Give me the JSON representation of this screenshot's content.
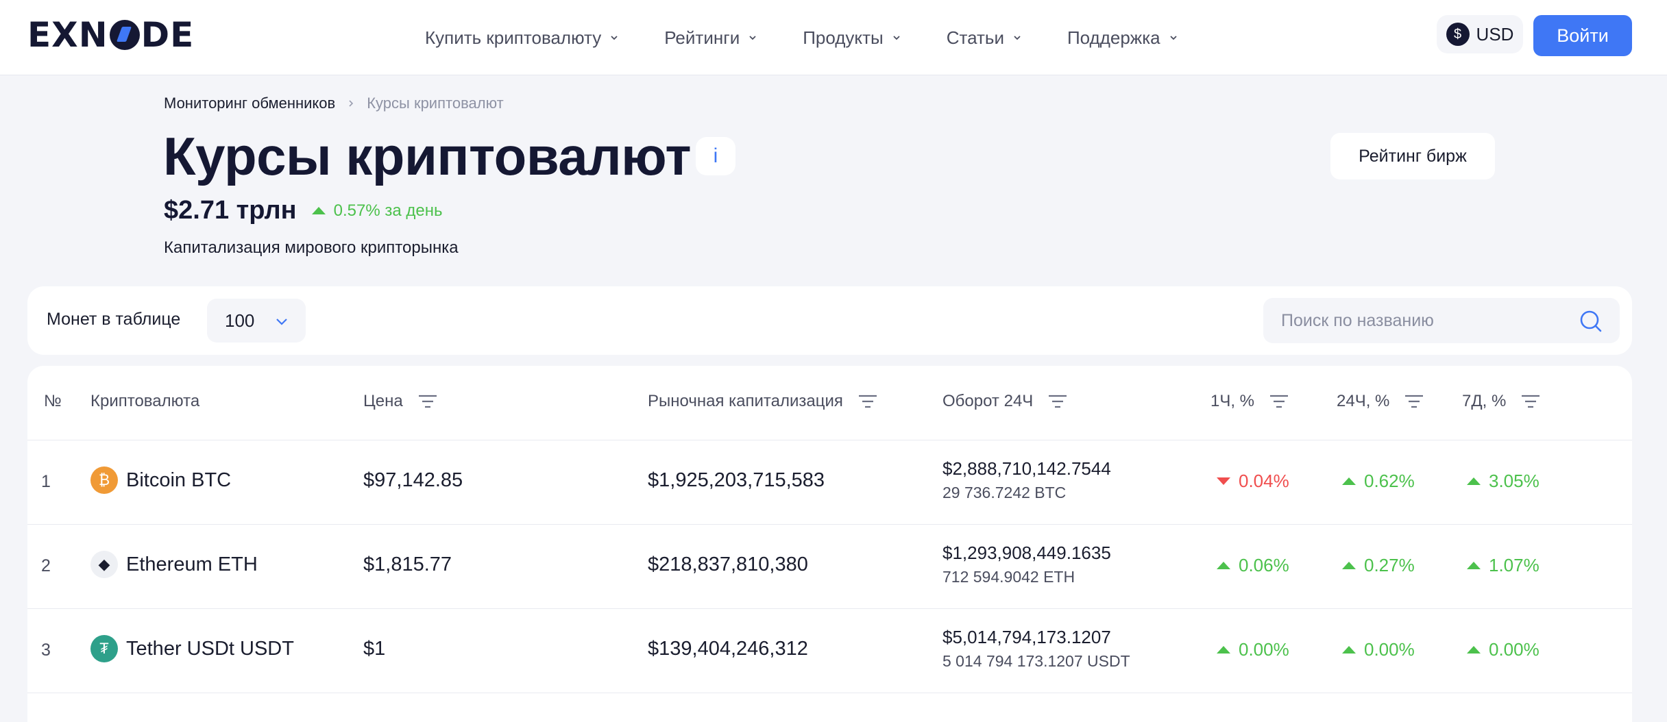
{
  "header": {
    "logo_parts": [
      "EXN",
      "DE"
    ],
    "nav": [
      {
        "label": "Купить криптовалюту"
      },
      {
        "label": "Рейтинги"
      },
      {
        "label": "Продукты"
      },
      {
        "label": "Статьи"
      },
      {
        "label": "Поддержка"
      }
    ],
    "currency": "USD",
    "currency_icon": "$",
    "login": "Войти"
  },
  "breadcrumb": {
    "root": "Мониторинг обменников",
    "current": "Курсы криптовалют"
  },
  "page": {
    "title": "Курсы криптовалют",
    "info": "i",
    "rating_button": "Рейтинг бирж",
    "cap_value": "$2.71 трлн",
    "cap_change": "0.57% за день",
    "cap_label": "Капитализация мирового крипторынка"
  },
  "filters": {
    "coins_label": "Монет в таблице",
    "coins_value": "100",
    "search_placeholder": "Поиск по названию"
  },
  "table": {
    "columns": {
      "num": "№",
      "coin": "Криптовалюта",
      "price": "Цена",
      "mcap": "Рыночная капитализация",
      "vol": "Оборот 24Ч",
      "h1": "1Ч, %",
      "h24": "24Ч, %",
      "d7": "7Д, %"
    },
    "rows": [
      {
        "num": "1",
        "name": "Bitcoin BTC",
        "icon_glyph": "₿",
        "icon_color": "#f09a36",
        "price": "$97,142.85",
        "mcap": "$1,925,203,715,583",
        "vol": "$2,888,710,142.7544",
        "vol_sub": "29 736.7242 BTC",
        "h1": "0.04%",
        "h24": "0.62%",
        "d7": "3.05%"
      },
      {
        "num": "2",
        "name": "Ethereum ETH",
        "icon_glyph": "◆",
        "icon_color": "#eef0f4",
        "price": "$1,815.77",
        "mcap": "$218,837,810,380",
        "vol": "$1,293,908,449.1635",
        "vol_sub": "712 594.9042 ETH",
        "h1": "0.06%",
        "h24": "0.27%",
        "d7": "1.07%"
      },
      {
        "num": "3",
        "name": "Tether USDt USDT",
        "icon_glyph": "₮",
        "icon_color": "#2ea08a",
        "price": "$1",
        "mcap": "$139,404,246,312",
        "vol": "$5,014,794,173.1207",
        "vol_sub": "5 014 794 173.1207 USDT",
        "h1": "0.00%",
        "h24": "0.00%",
        "d7": "0.00%"
      }
    ]
  },
  "colors": {
    "accent": "#3f77f5",
    "up": "#4cc14c",
    "down": "#f04e4e",
    "brand_dark": "#151833"
  }
}
